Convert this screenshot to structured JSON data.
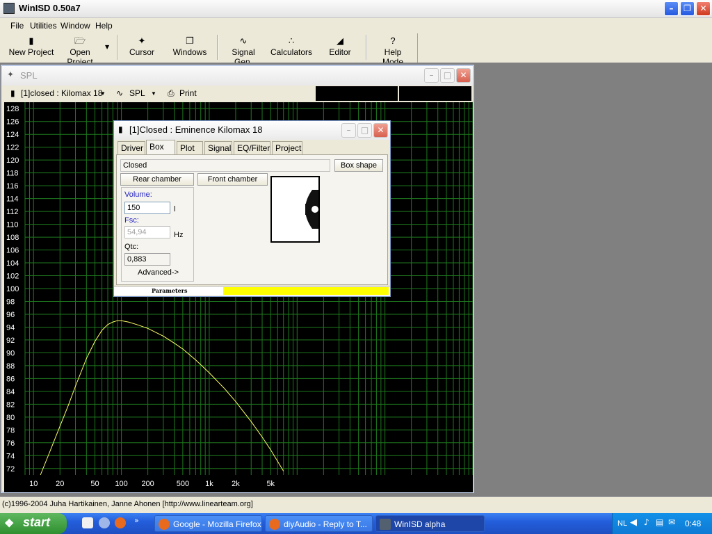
{
  "app": {
    "title": "WinISD 0.50a7"
  },
  "menu": [
    "File",
    "Utilities",
    "Window",
    "Help"
  ],
  "toolbar": [
    {
      "label": "New Project",
      "icon": "new-project-icon"
    },
    {
      "label": "Open Project",
      "icon": "open-folder-icon"
    },
    {
      "label": "Cursor",
      "icon": "cursor-icon"
    },
    {
      "label": "Windows",
      "icon": "windows-icon"
    },
    {
      "label": "Signal Gen.",
      "icon": "sine-wave-icon"
    },
    {
      "label": "Calculators",
      "icon": "calculator-icon"
    },
    {
      "label": "Editor",
      "icon": "speaker-editor-icon"
    },
    {
      "label": "Help Mode",
      "icon": "question-icon"
    }
  ],
  "spl_window": {
    "title": "SPL",
    "project_select": "[1]closed : Kilomax 18",
    "plot_select": "SPL",
    "print_label": "Print"
  },
  "chart_data": {
    "type": "line",
    "xscale": "log",
    "xlim": [
      8,
      1000000
    ],
    "ylim": [
      71,
      129
    ],
    "x_ticks": [
      "10",
      "20",
      "50",
      "100",
      "200",
      "500",
      "1k",
      "2k",
      "5k"
    ],
    "y_ticks": [
      72,
      74,
      76,
      78,
      80,
      82,
      84,
      86,
      88,
      90,
      92,
      94,
      96,
      98,
      100,
      102,
      104,
      106,
      108,
      110,
      112,
      114,
      116,
      118,
      120,
      122,
      124,
      126,
      128
    ],
    "grid": true,
    "line_color": "#ffff66",
    "grid_color": "#1e7a1e",
    "series": [
      {
        "x": [
          12,
          15,
          20,
          25,
          30,
          40,
          50,
          60,
          70,
          80,
          90,
          100,
          120,
          150,
          200,
          300,
          400,
          500,
          700,
          1000,
          1500,
          2000,
          3000,
          4000,
          5000,
          7000
        ],
        "y": [
          71.0,
          74.3,
          78.6,
          81.9,
          84.8,
          89.1,
          91.8,
          93.5,
          94.4,
          94.8,
          95.0,
          95.0,
          94.8,
          94.4,
          93.8,
          92.6,
          91.5,
          90.6,
          88.9,
          86.9,
          84.4,
          82.4,
          79.3,
          76.9,
          74.9,
          71.6
        ]
      }
    ]
  },
  "dialog": {
    "title": "[1]Closed : Eminence  Kilomax 18",
    "tabs": [
      "Driver",
      "Box",
      "Plot",
      "Signal",
      "EQ/Filter",
      "Project"
    ],
    "active_tab": "Box",
    "box_type": "Closed",
    "box_shape_label": "Box shape",
    "rear_chamber_label": "Rear chamber",
    "front_chamber_label": "Front chamber",
    "volume_label": "Volume:",
    "volume_value": "150",
    "volume_unit": "l",
    "fsc_label": "Fsc:",
    "fsc_value": "54,94",
    "fsc_unit": "Hz",
    "qtc_label": "Qtc:",
    "qtc_value": "0,883",
    "advanced_label": "Advanced->",
    "parameters_label": "Parameters",
    "indicator_color": "#ffff00"
  },
  "status": {
    "text": "(c)1996-2004 Juha Hartikainen, Janne Ahonen [http://www.linearteam.org]"
  },
  "taskbar": {
    "start_label": "start",
    "tasks": [
      "Google - Mozilla Firefox",
      "diyAudio - Reply to T...",
      "WinISD alpha"
    ],
    "lang": "NL",
    "clock": "0:48"
  }
}
